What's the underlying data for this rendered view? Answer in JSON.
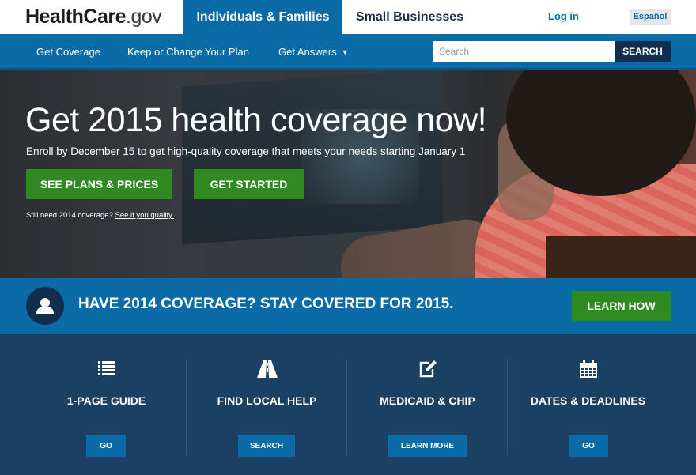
{
  "header": {
    "logo_bold": "HealthCare",
    "logo_light": ".gov",
    "tabs": [
      {
        "label": "Individuals & Families",
        "active": true
      },
      {
        "label": "Small Businesses",
        "active": false
      }
    ],
    "login_label": "Log in",
    "language_label": "Español"
  },
  "subnav": {
    "items": [
      {
        "label": "Get Coverage"
      },
      {
        "label": "Keep or Change Your Plan"
      },
      {
        "label": "Get Answers"
      }
    ],
    "search": {
      "placeholder": "Search",
      "value": "",
      "button_label": "SEARCH"
    }
  },
  "hero": {
    "title": "Get 2015 health coverage now!",
    "subtitle": "Enroll by December 15 to get high-quality coverage that meets your needs starting January 1",
    "primary_button": "SEE PLANS & PRICES",
    "secondary_button": "GET STARTED",
    "note_prefix": "Still need 2014 coverage?",
    "note_link": "See if you qualify."
  },
  "banner": {
    "headline": "HAVE 2014 COVERAGE? STAY COVERED FOR 2015.",
    "button_label": "LEARN HOW"
  },
  "tiles": [
    {
      "title": "1-PAGE GUIDE",
      "icon": "list-icon",
      "button": "GO"
    },
    {
      "title": "FIND LOCAL HELP",
      "icon": "road-icon",
      "button": "SEARCH"
    },
    {
      "title": "MEDICAID & CHIP",
      "icon": "edit-icon",
      "button": "LEARN MORE"
    },
    {
      "title": "DATES & DEADLINES",
      "icon": "calendar-icon",
      "button": "GO"
    }
  ],
  "colors": {
    "primary_blue": "#0b6ba6",
    "navy": "#112e51",
    "tile_background": "#1c3f64",
    "green": "#2e8a21"
  }
}
